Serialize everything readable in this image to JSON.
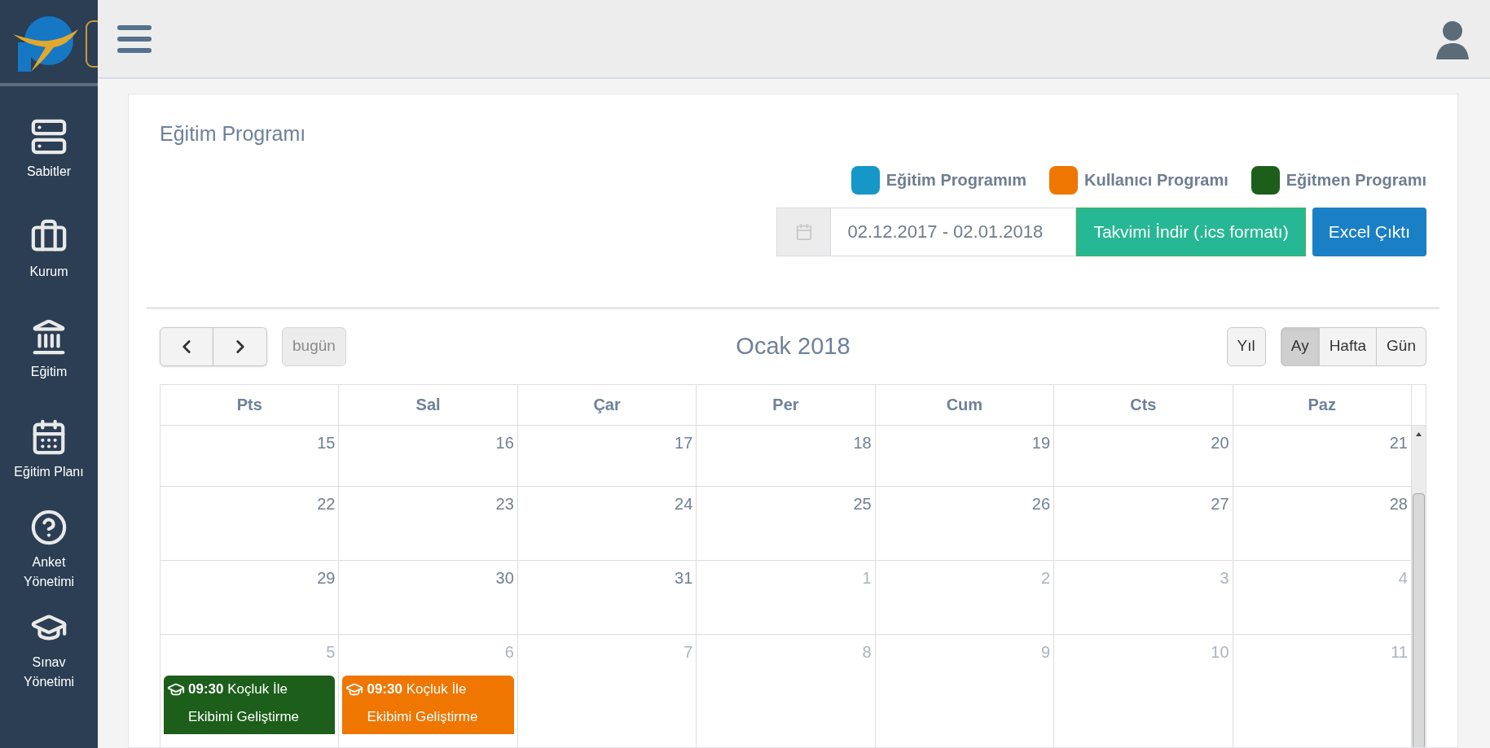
{
  "sidebar": {
    "items": [
      {
        "label": "Sabitler",
        "kind": "server"
      },
      {
        "label": "Kurum",
        "kind": "briefcase"
      },
      {
        "label": "Eğitim",
        "kind": "building"
      },
      {
        "label": "Eğitim Planı",
        "kind": "calendar"
      },
      {
        "label": "Anket Yönetimi",
        "kind": "question"
      },
      {
        "label": "Sınav Yönetimi",
        "kind": "cap"
      }
    ]
  },
  "page_title": "Eğitim Programı",
  "legend": [
    {
      "label": "Eğitim Programım",
      "color": "#1597c8"
    },
    {
      "label": "Kullanıcı Programı",
      "color": "#ef7600"
    },
    {
      "label": "Eğitmen Programı",
      "color": "#1c5e1a"
    }
  ],
  "date_range": {
    "value": "02.12.2017 - 02.01.2018"
  },
  "buttons": [
    {
      "label": "Takvimi İndir (.ics formatı)",
      "kind": "ics"
    },
    {
      "label": "Excel Çıktı",
      "kind": "excel"
    }
  ],
  "calendar": {
    "title": "Ocak 2018",
    "today_button": {
      "label": "bugün",
      "disabled": true
    },
    "year_button": "Yıl",
    "views": [
      {
        "label": "Ay",
        "selected": true
      },
      {
        "label": "Hafta",
        "selected": false
      },
      {
        "label": "Gün",
        "selected": false
      }
    ],
    "weekdays": [
      "Pts",
      "Sal",
      "Çar",
      "Per",
      "Cum",
      "Cts",
      "Paz"
    ],
    "weeks": [
      [
        {
          "day": "15",
          "other_month": false
        },
        {
          "day": "16",
          "other_month": false
        },
        {
          "day": "17",
          "other_month": false
        },
        {
          "day": "18",
          "other_month": false
        },
        {
          "day": "19",
          "other_month": false
        },
        {
          "day": "20",
          "other_month": false
        },
        {
          "day": "21",
          "other_month": false
        }
      ],
      [
        {
          "day": "22",
          "other_month": false
        },
        {
          "day": "23",
          "other_month": false
        },
        {
          "day": "24",
          "other_month": false
        },
        {
          "day": "25",
          "other_month": false
        },
        {
          "day": "26",
          "other_month": false
        },
        {
          "day": "27",
          "other_month": false
        },
        {
          "day": "28",
          "other_month": false
        }
      ],
      [
        {
          "day": "29",
          "other_month": false
        },
        {
          "day": "30",
          "other_month": false
        },
        {
          "day": "31",
          "other_month": false
        },
        {
          "day": "1",
          "other_month": true
        },
        {
          "day": "2",
          "other_month": true
        },
        {
          "day": "3",
          "other_month": true
        },
        {
          "day": "4",
          "other_month": true
        }
      ],
      [
        {
          "day": "5",
          "other_month": true,
          "events": [
            {
              "time": "09:30",
              "title": "Koçluk İle Ekibimi Geliştirme",
              "color": "#1c5e1a"
            }
          ]
        },
        {
          "day": "6",
          "other_month": true,
          "events": [
            {
              "time": "09:30",
              "title": "Koçluk İle Ekibimi Geliştirme",
              "color": "#ef7600"
            }
          ]
        },
        {
          "day": "7",
          "other_month": true
        },
        {
          "day": "8",
          "other_month": true
        },
        {
          "day": "9",
          "other_month": true
        },
        {
          "day": "10",
          "other_month": true
        },
        {
          "day": "11",
          "other_month": true
        }
      ]
    ]
  }
}
